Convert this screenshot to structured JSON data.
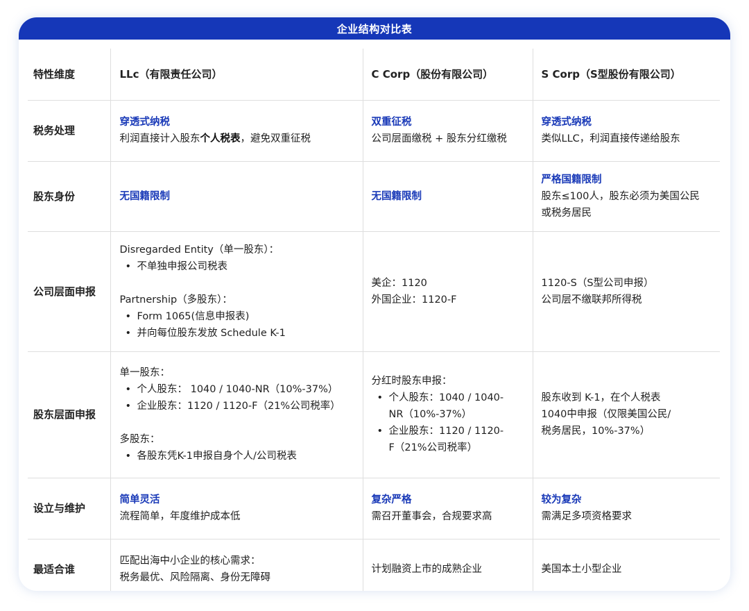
{
  "title": "企业结构对比表",
  "header": [
    "特性维度",
    "LLc（有限责任公司）",
    "C Corp（股份有限公司）",
    "S Corp（S型股份有限公司）"
  ],
  "rows": {
    "tax": {
      "label": "税务处理",
      "llc": {
        "highlight": "穿透式纳税",
        "text_before": "利润直接计入股东",
        "text_bold": "个人税表",
        "text_after": "，避免双重征税"
      },
      "ccorp": {
        "highlight": "双重征税",
        "text": "公司层面缴税 + 股东分红缴税"
      },
      "scorp": {
        "highlight": "穿透式纳税",
        "text": "类似LLC，利润直接传递给股东"
      }
    },
    "shareholder": {
      "label": "股东身份",
      "llc": {
        "highlight": "无国籍限制"
      },
      "ccorp": {
        "highlight": "无国籍限制"
      },
      "scorp": {
        "highlight": "严格国籍限制",
        "text1": "股东≤100人，股东必须为美国公民",
        "text2": "或税务居民"
      }
    },
    "corp_filing": {
      "label": "公司层面申报",
      "llc": {
        "heading1": "Disregarded Entity（单一股东）：",
        "bullet1": "不单独申报公司税表",
        "heading2": "Partnership（多股东）：",
        "bullet2": "Form 1065(信息申报表)",
        "bullet3": "并向每位股东发放 Schedule K-1"
      },
      "ccorp": {
        "line1": "美企：1120",
        "line2": "外国企业：1120-F"
      },
      "scorp": {
        "line1": "1120-S（S型公司申报）",
        "line2": "公司层不缴联邦所得税"
      }
    },
    "sh_filing": {
      "label": "股东层面申报",
      "llc": {
        "heading1": "单一股东：",
        "bullet1": "个人股东： 1040 / 1040-NR（10%-37%）",
        "bullet2": "企业股东：1120 / 1120-F（21%公司税率）",
        "heading2": "多股东：",
        "bullet3": "各股东凭K-1申报自身个人/公司税表"
      },
      "ccorp": {
        "heading": "分红时股东申报：",
        "bullet1a": "个人股东：1040 / 1040-",
        "bullet1b": "NR（10%-37%）",
        "bullet2a": "企业股东：1120 / 1120-",
        "bullet2b": "F（21%公司税率）"
      },
      "scorp": {
        "line1": "股东收到 K-1，在个人税表",
        "line2": "1040中申报（仅限美国公民/",
        "line3": "税务居民，10%-37%）"
      }
    },
    "setup": {
      "label": "设立与维护",
      "llc": {
        "highlight": "简单灵活",
        "text": "流程简单，年度维护成本低"
      },
      "ccorp": {
        "highlight": "复杂严格",
        "text": "需召开董事会，合规要求高"
      },
      "scorp": {
        "highlight": "较为复杂",
        "text": "需满足多项资格要求"
      }
    },
    "fit": {
      "label": "最适合谁",
      "llc": {
        "line1": "匹配出海中小企业的核心需求：",
        "line2": "税务最优、风险隔离、身份无障碍"
      },
      "ccorp": {
        "text": "计划融资上市的成熟企业"
      },
      "scorp": {
        "text": "美国本土小型企业"
      }
    }
  },
  "icons": {
    "bullet": "•"
  },
  "colors": {
    "accent": "#1537b8",
    "highlight_text": "#1a3ab8",
    "divider": "#dedede"
  }
}
